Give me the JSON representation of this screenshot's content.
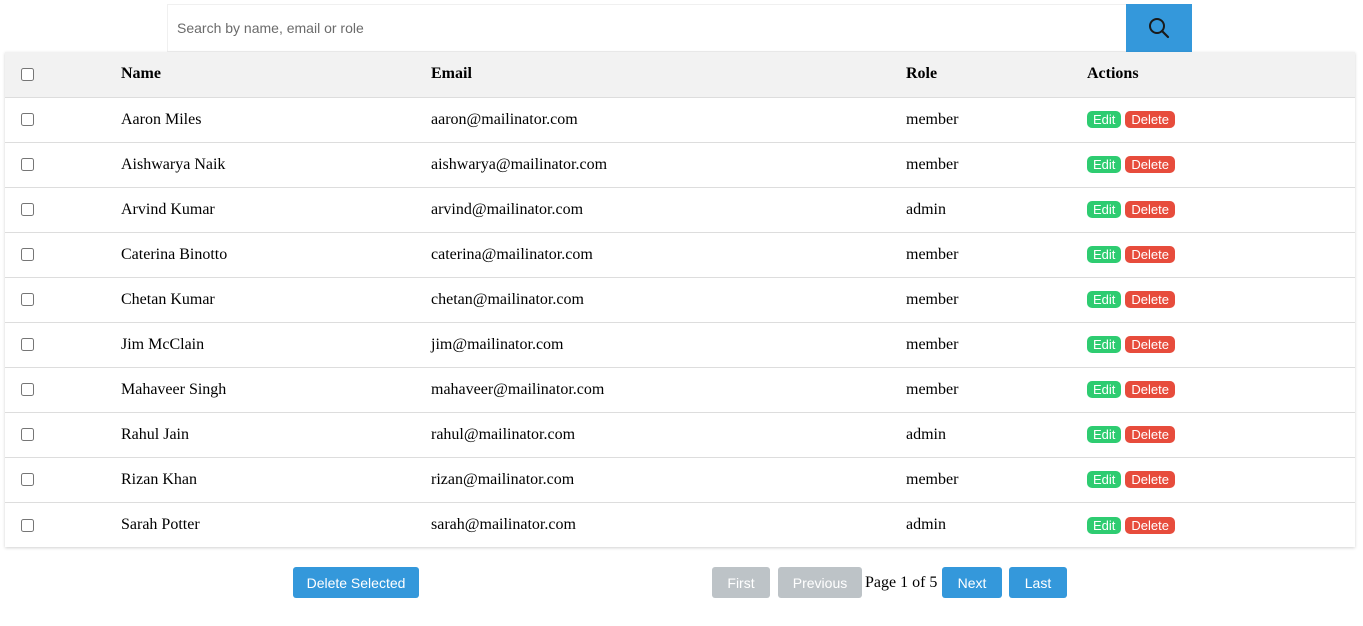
{
  "search": {
    "placeholder": "Search by name, email or role",
    "value": "",
    "button_icon": "search-icon"
  },
  "table": {
    "headers": {
      "name": "Name",
      "email": "Email",
      "role": "Role",
      "actions": "Actions"
    },
    "rows": [
      {
        "name": "Aaron Miles",
        "email": "aaron@mailinator.com",
        "role": "member"
      },
      {
        "name": "Aishwarya Naik",
        "email": "aishwarya@mailinator.com",
        "role": "member"
      },
      {
        "name": "Arvind Kumar",
        "email": "arvind@mailinator.com",
        "role": "admin"
      },
      {
        "name": "Caterina Binotto",
        "email": "caterina@mailinator.com",
        "role": "member"
      },
      {
        "name": "Chetan Kumar",
        "email": "chetan@mailinator.com",
        "role": "member"
      },
      {
        "name": "Jim McClain",
        "email": "jim@mailinator.com",
        "role": "member"
      },
      {
        "name": "Mahaveer Singh",
        "email": "mahaveer@mailinator.com",
        "role": "member"
      },
      {
        "name": "Rahul Jain",
        "email": "rahul@mailinator.com",
        "role": "admin"
      },
      {
        "name": "Rizan Khan",
        "email": "rizan@mailinator.com",
        "role": "member"
      },
      {
        "name": "Sarah Potter",
        "email": "sarah@mailinator.com",
        "role": "admin"
      }
    ],
    "edit_label": "Edit",
    "delete_label": "Delete"
  },
  "footer": {
    "delete_selected_label": "Delete Selected",
    "first_label": "First",
    "previous_label": "Previous",
    "page_info": "Page 1 of 5",
    "next_label": "Next",
    "last_label": "Last"
  },
  "colors": {
    "primary": "#3498db",
    "edit": "#2ecc71",
    "delete": "#e74c3c",
    "disabled": "#bdc3c7",
    "header_bg": "#f2f2f2"
  }
}
